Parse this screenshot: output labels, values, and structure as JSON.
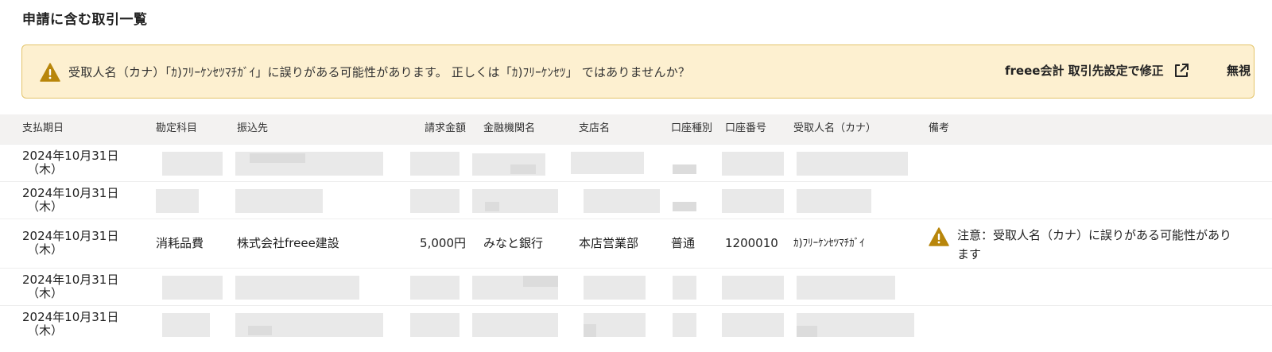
{
  "section": {
    "title": "申請に含む取引一覧"
  },
  "alert": {
    "message": "受取人名（カナ）「ｶ)ﾌﾘｰｹﾝｾﾂﾏﾁｶﾞｲ」に誤りがある可能性があります。 正しくは「ｶ)ﾌﾘｰｹﾝｾﾂ」 ではありませんか？",
    "fix_link_label": "freee会計 取引先設定で修正",
    "ignore_label": "無視",
    "accent_color": "#b8860b",
    "background_color": "#fdf0d0"
  },
  "table": {
    "headers": {
      "due_date": "支払期日",
      "account": "勘定科目",
      "payee": "振込先",
      "amount": "請求金額",
      "bank": "金融機関名",
      "branch": "支店名",
      "account_type": "口座種別",
      "account_number": "口座番号",
      "recipient_kana": "受取人名（カナ）",
      "note": "備考"
    },
    "rows": [
      {
        "date_line1": "2024年10月31日",
        "date_line2": "（木）",
        "redacted": true
      },
      {
        "date_line1": "2024年10月31日",
        "date_line2": "（木）",
        "redacted": true
      },
      {
        "date_line1": "2024年10月31日",
        "date_line2": "（木）",
        "redacted": false,
        "account": "消耗品費",
        "payee": "株式会社freee建設",
        "amount": "5,000円",
        "bank": "みなと銀行",
        "branch": "本店営業部",
        "account_type": "普通",
        "account_number": "1200010",
        "recipient_kana": "ｶ)ﾌﾘｰｹﾝｾﾂﾏﾁｶﾞｲ",
        "note": "注意：受取人名（カナ）に誤りがある可能性があります"
      },
      {
        "date_line1": "2024年10月31日",
        "date_line2": "（木）",
        "redacted": true
      },
      {
        "date_line1": "2024年10月31日",
        "date_line2": "（木）",
        "redacted": true
      }
    ]
  },
  "icons": {
    "alert_icon": "warning-triangle-icon",
    "link_icon": "external-link-icon",
    "note_icon": "warning-triangle-icon"
  }
}
